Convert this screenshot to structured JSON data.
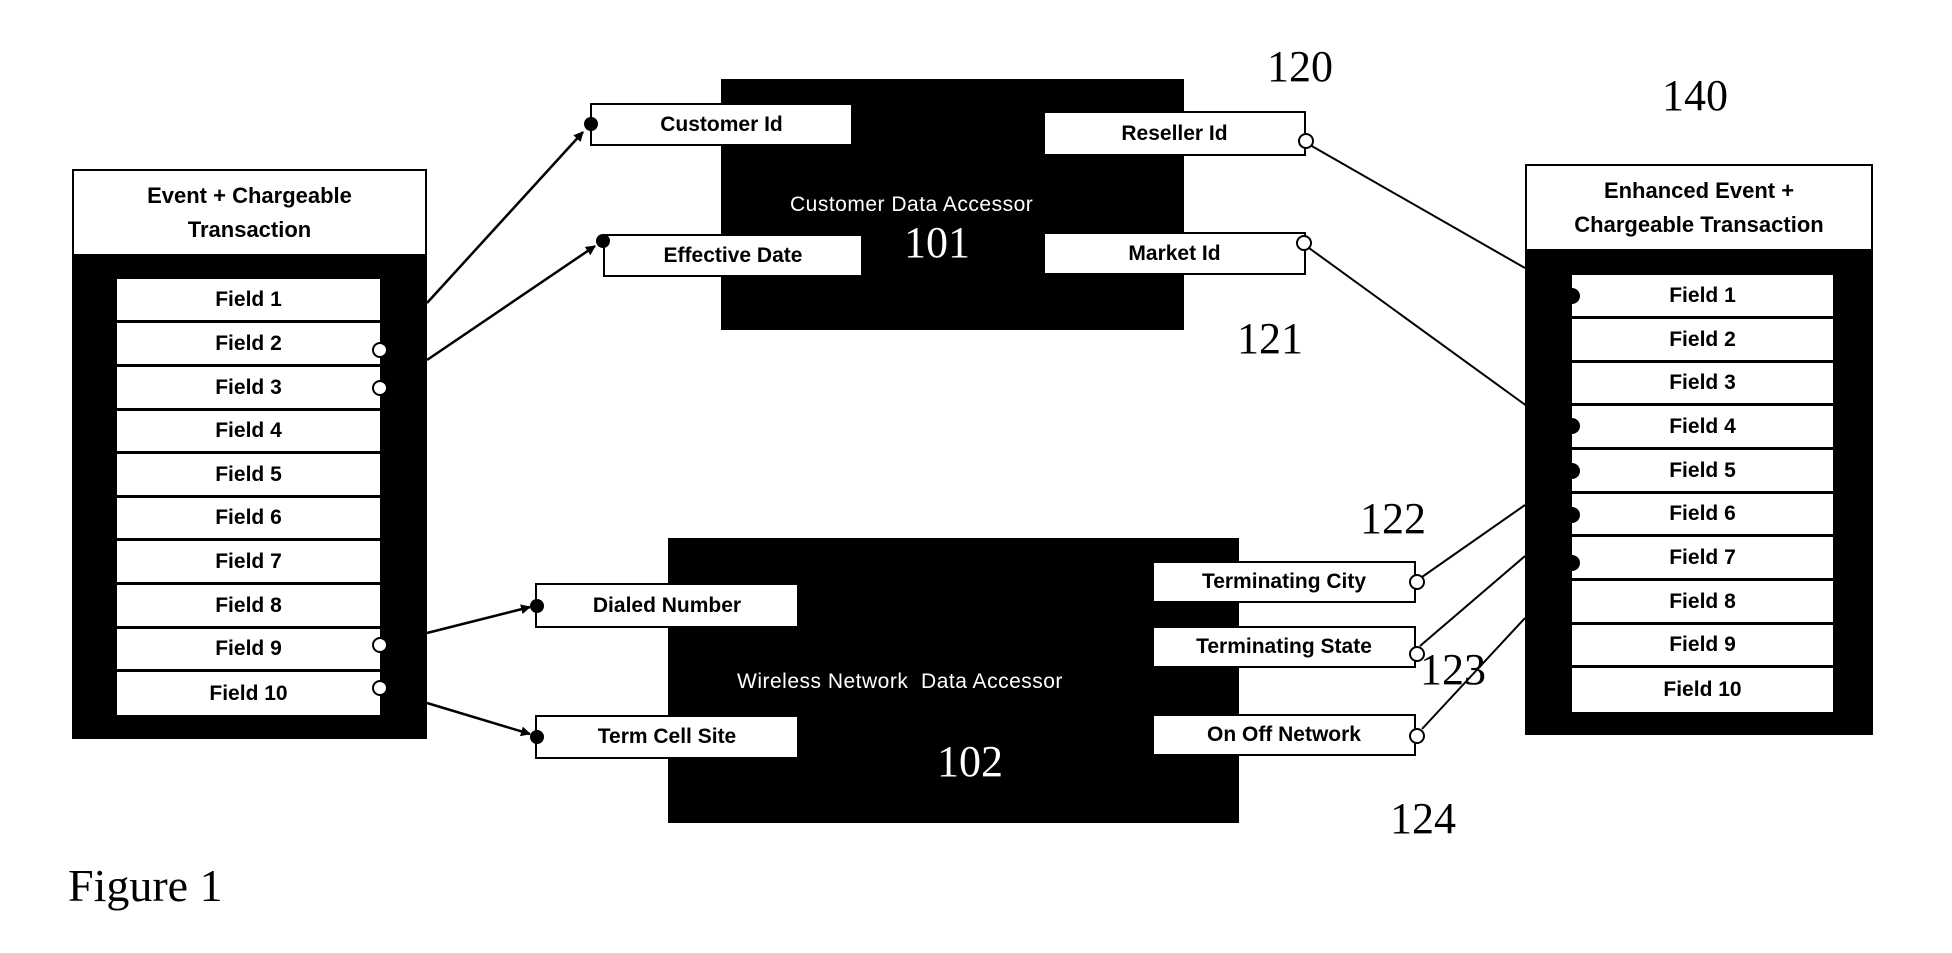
{
  "caption": "Figure 1",
  "source_record": {
    "title_line1": "Event + Chargeable",
    "title_line2": "Transaction",
    "fields": [
      "Field 1",
      "Field 2",
      "Field 3",
      "Field 4",
      "Field 5",
      "Field 6",
      "Field 7",
      "Field 8",
      "Field 9",
      "Field 10"
    ]
  },
  "customer_accessor": {
    "title": "Customer Data Accessor",
    "ref": "101",
    "inputs": [
      "Customer Id",
      "Effective Date"
    ],
    "outputs": [
      "Reseller Id",
      "Market Id"
    ],
    "output_refs": [
      "120",
      "121"
    ]
  },
  "network_accessor": {
    "title": "Wireless Network  Data Accessor",
    "ref": "102",
    "inputs": [
      "Dialed Number",
      "Term Cell Site"
    ],
    "outputs": [
      "Terminating City",
      "Terminating State",
      "On Off Network"
    ],
    "output_refs": [
      "122",
      "123",
      "124"
    ]
  },
  "enhanced_record": {
    "ref": "140",
    "title_line1": "Enhanced Event +",
    "title_line2": "Chargeable Transaction",
    "fields": [
      "Field 1",
      "Field 2",
      "Field 3",
      "Field 4",
      "Field 5",
      "Field 6",
      "Field 7",
      "Field 8",
      "Field 9",
      "Field 10"
    ]
  },
  "connections": [
    {
      "from": "source_record.Field 2",
      "to": "customer_accessor.Customer Id"
    },
    {
      "from": "source_record.Field 3",
      "to": "customer_accessor.Effective Date"
    },
    {
      "from": "source_record.Field 9",
      "to": "network_accessor.Dialed Number"
    },
    {
      "from": "source_record.Field 10",
      "to": "network_accessor.Term Cell Site"
    },
    {
      "from": "customer_accessor.Reseller Id",
      "to": "enhanced_record.Field 1"
    },
    {
      "from": "customer_accessor.Market Id",
      "to": "enhanced_record.Field 4"
    },
    {
      "from": "network_accessor.Terminating City",
      "to": "enhanced_record.Field 5"
    },
    {
      "from": "network_accessor.Terminating State",
      "to": "enhanced_record.Field 6"
    },
    {
      "from": "network_accessor.On Off Network",
      "to": "enhanced_record.Field 7"
    }
  ]
}
